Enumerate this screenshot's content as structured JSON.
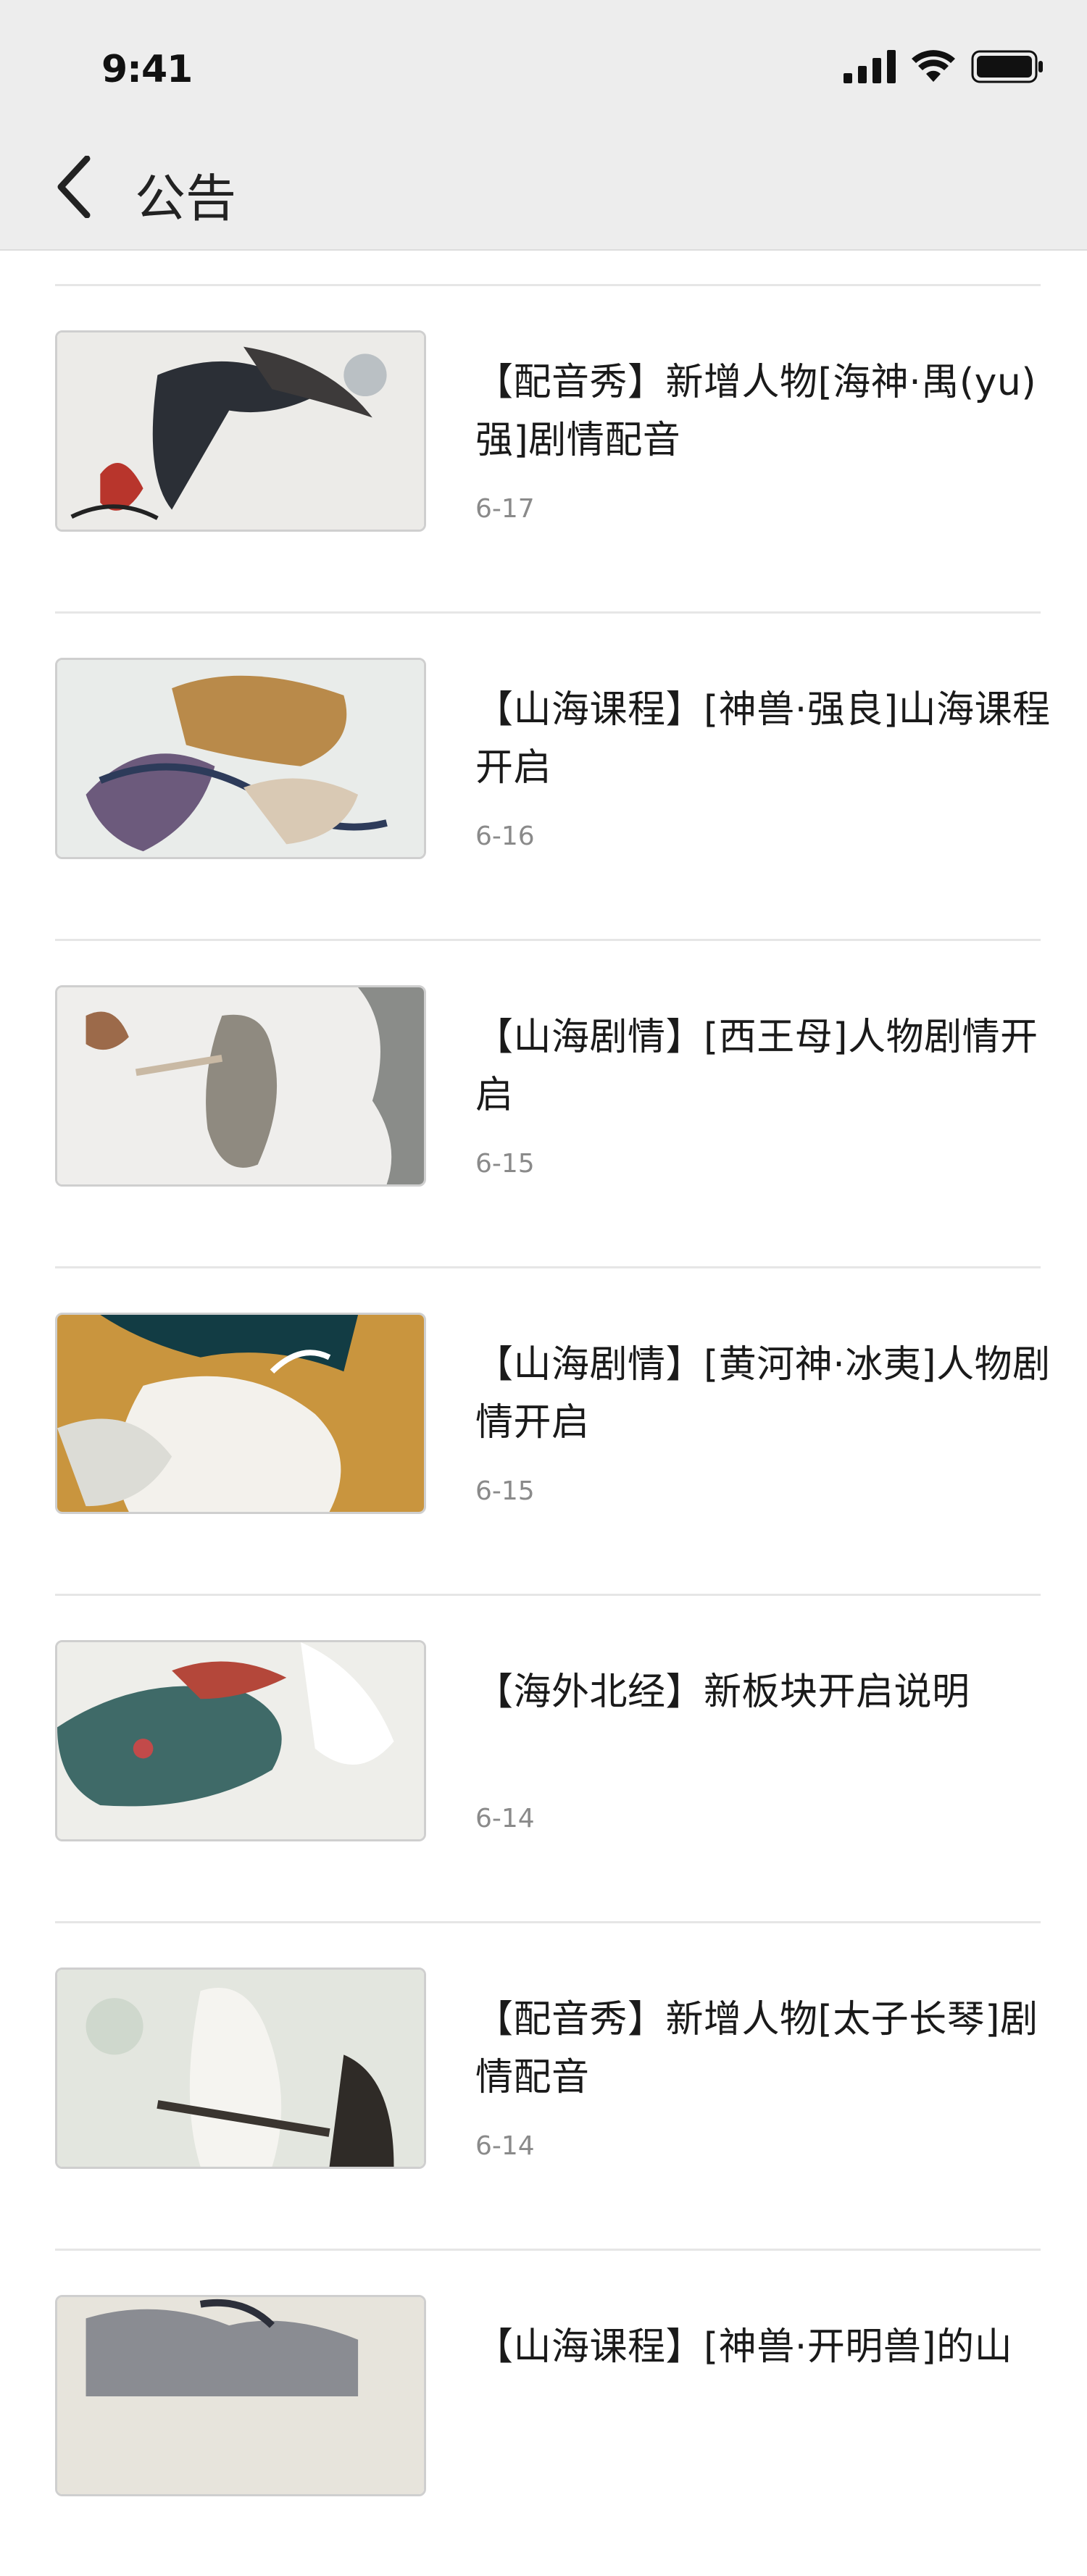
{
  "status_bar": {
    "time": "9:41"
  },
  "nav": {
    "title": "公告",
    "back_icon": "chevron-left-icon"
  },
  "announcements": [
    {
      "title": "【配音秀】新增人物[海神·禺(yu)强]剧情配音",
      "date": "6-17"
    },
    {
      "title": "【山海课程】[神兽·强良]山海课程开启",
      "date": "6-16"
    },
    {
      "title": "【山海剧情】[西王母]人物剧情开启",
      "date": "6-15"
    },
    {
      "title": "【山海剧情】[黄河神·冰夷]人物剧情开启",
      "date": "6-15"
    },
    {
      "title": "【海外北经】新板块开启说明",
      "date": "6-14"
    },
    {
      "title": "【配音秀】新增人物[太子长琴]剧情配音",
      "date": "6-14"
    },
    {
      "title": "【山海课程】[神兽·开明兽]的山",
      "date": ""
    }
  ],
  "colors": {
    "header_bg": "#ededed",
    "separator": "#e6e6e6",
    "date_text": "#8a8a8a"
  }
}
